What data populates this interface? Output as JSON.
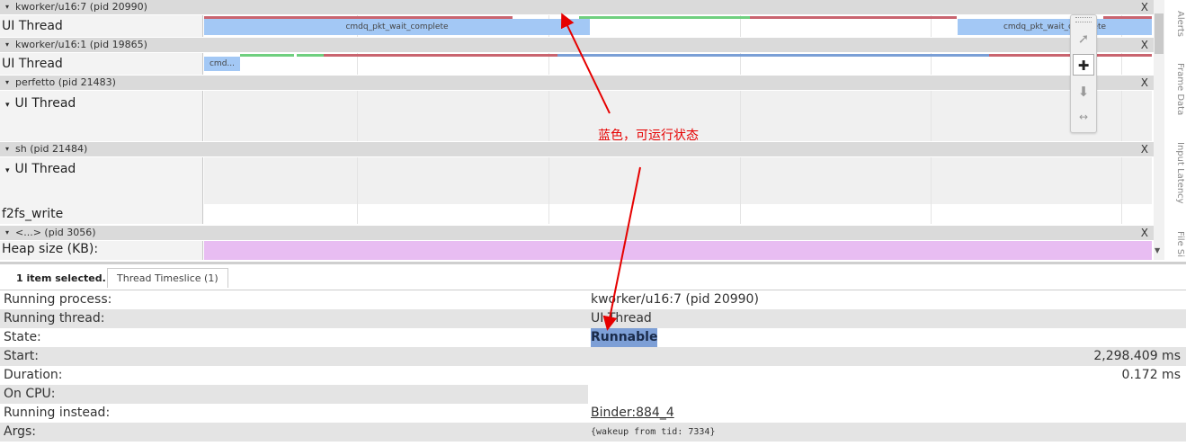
{
  "tracks": {
    "p1": {
      "name": "kworker/u16:7 (pid 20990)",
      "close": "X",
      "thread": "UI Thread",
      "slice1": "cmdq_pkt_wait_complete",
      "slice2": "cmdq_pkt_wait_complete"
    },
    "p2": {
      "name": "kworker/u16:1 (pid 19865)",
      "close": "X",
      "thread": "UI Thread",
      "slice1": "cmd..."
    },
    "p3": {
      "name": "perfetto (pid 21483)",
      "close": "X",
      "thread": "UI Thread"
    },
    "p4": {
      "name": "sh (pid 21484)",
      "close": "X",
      "thread": "UI Thread",
      "sub": "f2fs_write"
    },
    "p5": {
      "name": "<...> (pid 3056)",
      "close": "X",
      "counter": "Heap size (KB):"
    }
  },
  "collapse_icon": "triangle-down-icon",
  "side_tabs": [
    "Alerts",
    "Frame Data",
    "Input Latency",
    "File Si"
  ],
  "toolbar": [
    "pointer-icon",
    "pan-icon",
    "zoom-icon",
    "timing-icon"
  ],
  "annotation": "蓝色，可运行状态",
  "details": {
    "selected_tab": "1 item selected.",
    "timeslice_tab": "Thread Timeslice (1)",
    "rows": [
      {
        "key": "Running process:",
        "value": "kworker/u16:7 (pid 20990)"
      },
      {
        "key": "Running thread:",
        "value": "UI Thread"
      },
      {
        "key": "State:",
        "value": "Runnable"
      },
      {
        "key": "Start:",
        "value": "2,298.409 ms"
      },
      {
        "key": "Duration:",
        "value": "0.172 ms"
      },
      {
        "key": "On CPU:",
        "value": ""
      },
      {
        "key": "Running instead:",
        "value": "Binder:884_4"
      },
      {
        "key": "Args:",
        "value": "{wakeup from tid: 7334}"
      }
    ]
  },
  "colors": {
    "runnable": "#a3c8f5",
    "running": "#6fcf7f",
    "sleeping_strip": "#c9646f",
    "heap": "#e8bdf2",
    "annotation": "#e60000",
    "state_highlight": "#7d9fd6"
  }
}
